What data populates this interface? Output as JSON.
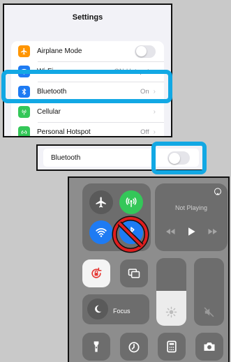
{
  "settings": {
    "title": "Settings",
    "rows": [
      {
        "label": "Airplane Mode",
        "value": ""
      },
      {
        "label": "Wi-Fi",
        "value": "GN-Hotspot"
      },
      {
        "label": "Bluetooth",
        "value": "On"
      },
      {
        "label": "Cellular",
        "value": ""
      },
      {
        "label": "Personal Hotspot",
        "value": "Off"
      }
    ]
  },
  "bluetooth_row": {
    "label": "Bluetooth"
  },
  "control_center": {
    "now_playing": "Not Playing",
    "focus": "Focus"
  },
  "colors": {
    "airplane": "#ff9500",
    "wifi": "#1e7bf3",
    "bluetooth": "#1e7bf3",
    "cellular": "#34c759",
    "hotspot": "#34c759",
    "highlight": "#12a8e4",
    "prohibited": "#e01e1e"
  }
}
